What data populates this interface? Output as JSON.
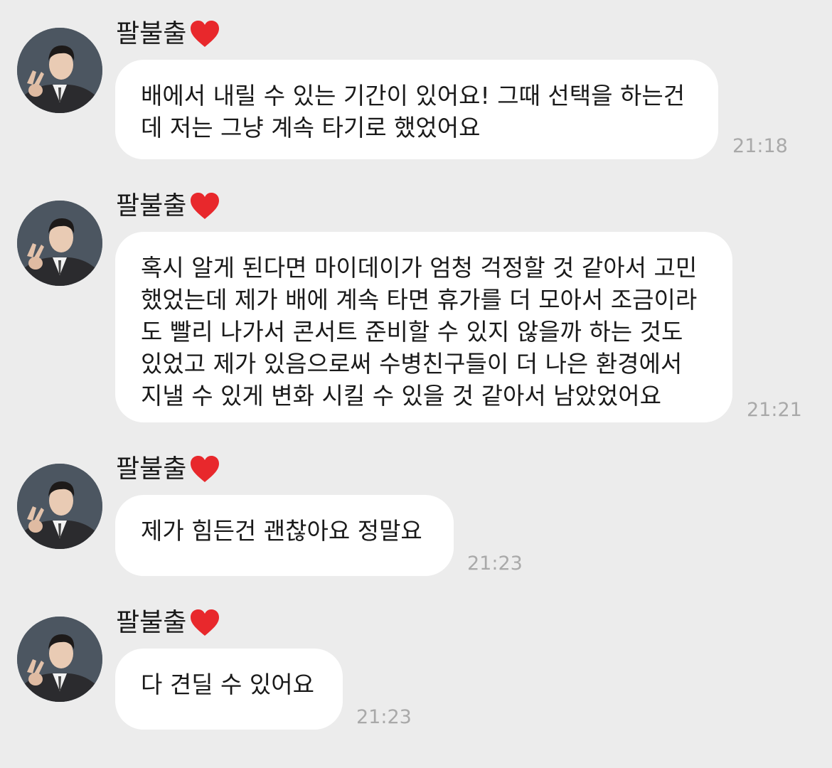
{
  "chat": {
    "messages": [
      {
        "sender": "팔불출",
        "text": "배에서 내릴 수 있는 기간이 있어요! 그때 선택을 하는건\n데 저는 그냥 계속 타기로 했었어요",
        "time": "21:18"
      },
      {
        "sender": "팔불출",
        "text": "혹시 알게 된다면 마이데이가 엄청 걱정할 것 같아서 고민\n했었는데 제가 배에 계속 타면 휴가를 더 모아서 조금이라\n도 빨리 나가서 콘서트 준비할 수 있지 않을까 하는 것도\n있었고 제가 있음으로써 수병친구들이 더 나은 환경에서\n지낼 수 있게 변화 시킬 수 있을 것 같아서 남았었어요",
        "time": "21:21"
      },
      {
        "sender": "팔불출",
        "text": "제가 힘든건 괜찮아요 정말요",
        "time": "21:23"
      },
      {
        "sender": "팔불출",
        "text": "다 견딜 수 있어요",
        "time": "21:23"
      }
    ]
  },
  "icons": {
    "sender_badge": "heart-icon",
    "avatar": "profile-photo"
  },
  "colors": {
    "background": "#ececec",
    "bubble": "#ffffff",
    "timestamp": "#a9a9a9",
    "heart": "#e8282c"
  }
}
